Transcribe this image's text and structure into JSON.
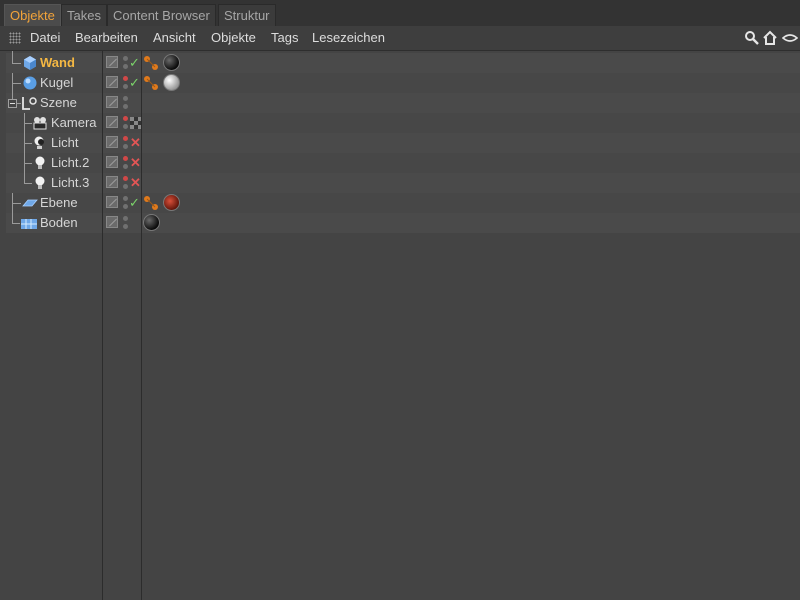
{
  "tabs": [
    {
      "label": "Objekte",
      "active": true
    },
    {
      "label": "Takes",
      "active": false
    },
    {
      "label": "Content Browser",
      "active": false
    },
    {
      "label": "Struktur",
      "active": false
    }
  ],
  "menu": [
    "Datei",
    "Bearbeiten",
    "Ansicht",
    "Objekte",
    "Tags",
    "Lesezeichen"
  ],
  "toolbar_icons": [
    "search-icon",
    "home-icon",
    "eye-icon"
  ],
  "objects": [
    {
      "name": "Wand",
      "icon": "cube-icon",
      "selected": true,
      "level": 1,
      "state": "check",
      "tags": [
        "phong",
        "material-black"
      ]
    },
    {
      "name": "Kugel",
      "icon": "sphere-icon",
      "selected": false,
      "level": 1,
      "state": "check",
      "tags": [
        "phong",
        "material-white"
      ]
    },
    {
      "name": "Szene",
      "icon": "null-icon",
      "selected": false,
      "level": 0,
      "state": "none",
      "tags": []
    },
    {
      "name": "Kamera",
      "icon": "camera-icon",
      "selected": false,
      "level": 2,
      "state": "target",
      "tags": []
    },
    {
      "name": "Licht",
      "icon": "spotlight-icon",
      "selected": false,
      "level": 2,
      "state": "cross",
      "tags": []
    },
    {
      "name": "Licht.2",
      "icon": "light-icon",
      "selected": false,
      "level": 2,
      "state": "cross",
      "tags": []
    },
    {
      "name": "Licht.3",
      "icon": "light-icon",
      "selected": false,
      "level": 2,
      "state": "cross",
      "tags": []
    },
    {
      "name": "Ebene",
      "icon": "plane-icon",
      "selected": false,
      "level": 1,
      "state": "check",
      "tags": [
        "phong",
        "material-red"
      ]
    },
    {
      "name": "Boden",
      "icon": "floor-icon",
      "selected": false,
      "level": 1,
      "state": "none",
      "tags": [
        "material-black"
      ]
    }
  ],
  "colors": {
    "selected_text": "#f5b843",
    "accent_tab": "#f2a33a",
    "check": "#7bd36a",
    "cross": "#e25555"
  }
}
